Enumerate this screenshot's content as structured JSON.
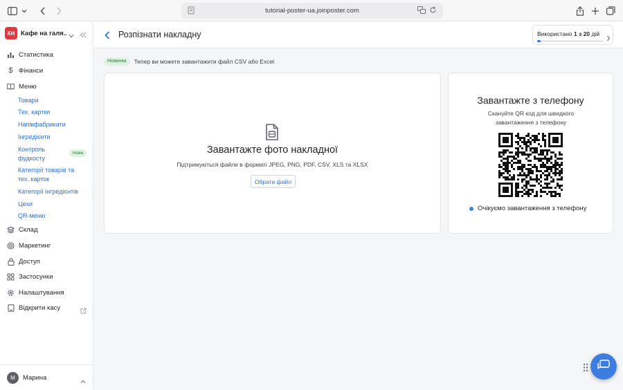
{
  "browser": {
    "url": "tutorial-poster-ua.joinposter.com"
  },
  "sidebar": {
    "org_badge": "КН",
    "org_name": "Кафе на галя...",
    "items": [
      {
        "label": "Статистика",
        "icon": "chart-icon"
      },
      {
        "label": "Фінанси",
        "icon": "dollar-icon"
      },
      {
        "label": "Меню",
        "icon": "book-icon"
      },
      {
        "label": "Склад",
        "icon": "layers-icon"
      },
      {
        "label": "Маркетинг",
        "icon": "target-icon"
      },
      {
        "label": "Доступ",
        "icon": "lock-icon"
      },
      {
        "label": "Застосунки",
        "icon": "apps-icon"
      },
      {
        "label": "Налаштування",
        "icon": "gear-icon"
      },
      {
        "label": "Відкрити касу",
        "icon": "tablet-icon"
      }
    ],
    "menu_sub": [
      "Товари",
      "Тех. картки",
      "Напівфабрикати",
      "Інгредієнти",
      "Контроль фудкосту",
      "Категорії товарів та тех. карток",
      "Категорії інгредієнтів",
      "Цехи",
      "QR-меню"
    ],
    "new_badge": "Нове",
    "user_initial": "М",
    "user_name": "Марина"
  },
  "header": {
    "title": "Розпізнати накладну",
    "usage_prefix": "Використано",
    "usage_count": "1 з 20",
    "usage_suffix": "дій",
    "usage_fraction": 0.05
  },
  "notice": {
    "badge": "Новинка",
    "text": "Тепер ви можете завантажити файл CSV або Excel"
  },
  "upload": {
    "title": "Завантажте фото накладної",
    "subtitle": "Підтримуються файли в форматі JPEG, PNG, PDF, CSV, XLS та XLSX",
    "button": "Обрати файл"
  },
  "phone": {
    "title": "Завантажте з телефону",
    "subtitle": "Скануйте QR код для швидкого завантаження з телефону",
    "status": "Очікуємо завантаження з телефону"
  },
  "colors": {
    "accent": "#3d7de0",
    "badge_red": "#e0373e",
    "badge_green_bg": "#dff3e3"
  }
}
